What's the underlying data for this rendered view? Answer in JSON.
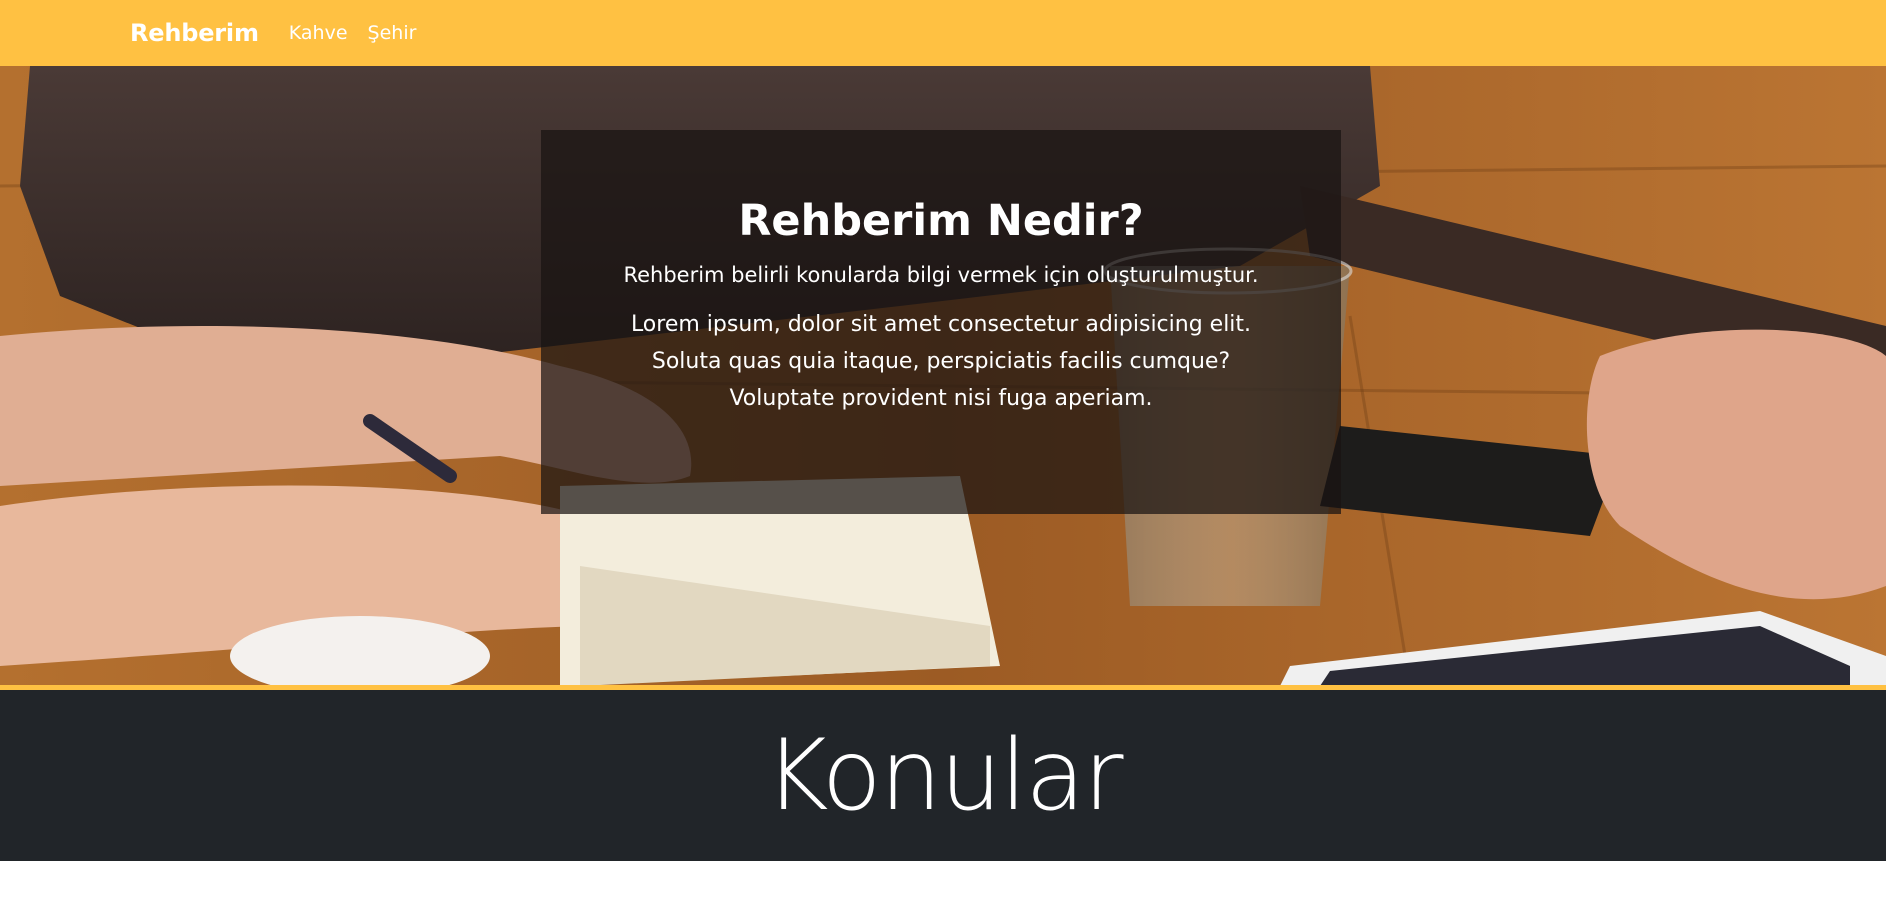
{
  "navbar": {
    "brand": "Rehberim",
    "links": [
      {
        "label": "Kahve"
      },
      {
        "label": "Şehir"
      }
    ],
    "background_color": "#ffc142"
  },
  "hero": {
    "title": "Rehberim Nedir?",
    "subtitle": "Rehberim belirli konularda bilgi vermek için oluşturulmuştur.",
    "body": "Lorem ipsum, dolor sit amet consectetur adipisicing elit. Soluta quas quia itaque, perspiciatis facilis cumque? Voluptate provident nisi fuga aperiam."
  },
  "section": {
    "title": "Konular",
    "background_color": "#212529"
  }
}
